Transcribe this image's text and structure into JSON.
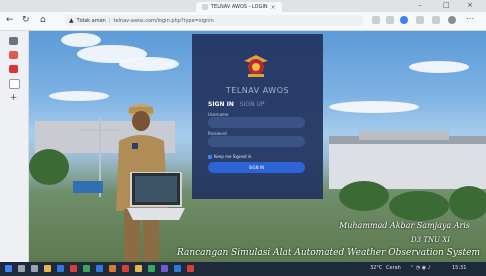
{
  "browser": {
    "tab_title": "TELNAV AWOS - LOGIN",
    "window_controls": [
      "–",
      "□",
      "×"
    ],
    "security_label": "Tidak aman",
    "url": "telnav-awos.com/login.php?type=signin"
  },
  "login": {
    "brand": "TELNAV AWOS",
    "tab_signin": "SIGN IN",
    "tab_signup": "SIGN UP",
    "username_label": "Username",
    "password_label": "Password",
    "keep_signed_in": "Keep me Signed in",
    "signin_button": "SIGN IN"
  },
  "captions": {
    "name": "Muhammad Akbar Samjaya Aris",
    "unit": "D3 TNU XI",
    "title": "Rancangan Simulasi Alat Automated Weather Observation System"
  },
  "taskbar": {
    "weather": "32°C",
    "weather_desc": "Cerah",
    "clock": "15:31"
  }
}
